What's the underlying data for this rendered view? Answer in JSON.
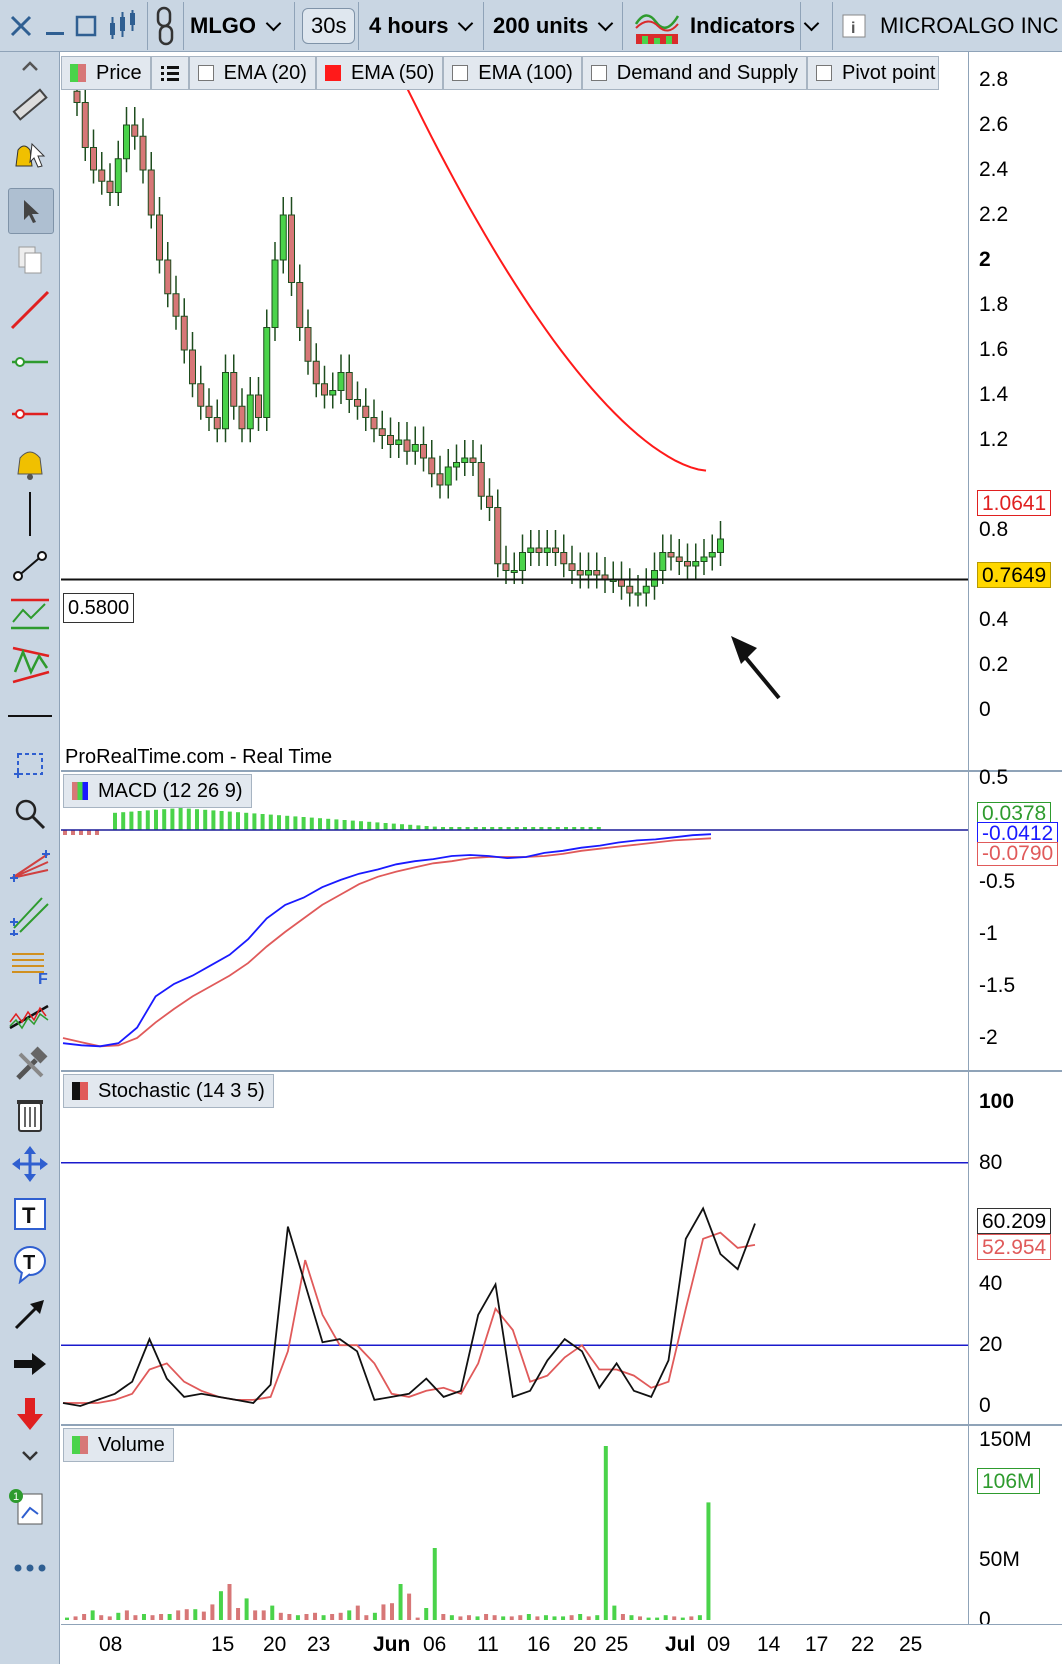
{
  "toolbar": {
    "symbol": "MLGO",
    "refresh": "30s",
    "period": "4 hours",
    "units": "200 units",
    "indicators": "Indicators",
    "instrument": "MICROALGO INC"
  },
  "price_panel": {
    "legend": [
      "Price",
      "EMA (20)",
      "EMA (50)",
      "EMA (100)",
      "Demand and Supply",
      "Pivot point"
    ],
    "source": "ProRealTime.com - Real Time",
    "hline_label": "0.5800",
    "ema50_value": "1.0641",
    "last_price": "0.7649",
    "yticks": [
      "2.8",
      "2.6",
      "2.4",
      "2.2",
      "2",
      "1.8",
      "1.6",
      "1.4",
      "1.2",
      "",
      "0.8",
      "0.6",
      "0.4",
      "0.2",
      "0"
    ]
  },
  "macd_panel": {
    "legend": "MACD (12 26 9)",
    "hist_value": "0.0378",
    "macd_value": "-0.0412",
    "signal_value": "-0.0790",
    "yticks": [
      "0.5",
      "-0.5",
      "-1",
      "-1.5",
      "-2"
    ]
  },
  "stoch_panel": {
    "legend": "Stochastic (14 3 5)",
    "k_value": "60.209",
    "d_value": "52.954",
    "yticks": [
      "100",
      "80",
      "40",
      "20",
      "0"
    ]
  },
  "volume_panel": {
    "legend": "Volume",
    "value": "106M",
    "yticks": [
      "150M",
      "50M",
      "0"
    ]
  },
  "xaxis": [
    "08",
    "15",
    "20",
    "23",
    "Jun",
    "06",
    "11",
    "16",
    "20",
    "25",
    "Jul",
    "09",
    "14",
    "17",
    "22",
    "25"
  ],
  "colors": {
    "up": "#4ad34a",
    "down": "#d77777",
    "ema50": "#ff1a1a",
    "macd": "#1a1aff",
    "signal": "#e05a5a",
    "stoch_level": "#1a1acc",
    "toolbar_bg": "#c9d6e3",
    "price_tag": "#ffd700"
  },
  "chart_data": [
    {
      "type": "candlestick",
      "title": "Price",
      "ylim": [
        0,
        2.9
      ],
      "hline": 0.58,
      "ema50_last": 1.0641,
      "last": 0.7649,
      "series": [
        {
          "name": "Price",
          "values": [
            2.7,
            2.5,
            2.4,
            2.35,
            2.3,
            2.45,
            2.6,
            2.55,
            2.4,
            2.2,
            2.0,
            1.85,
            1.75,
            1.6,
            1.45,
            1.35,
            1.3,
            1.25,
            1.5,
            1.35,
            1.25,
            1.4,
            1.3,
            1.7,
            2.0,
            2.2,
            1.9,
            1.7,
            1.55,
            1.45,
            1.4,
            1.42,
            1.5,
            1.38,
            1.35,
            1.3,
            1.25,
            1.22,
            1.18,
            1.2,
            1.15,
            1.18,
            1.12,
            1.05,
            1.0,
            1.08,
            1.1,
            1.12,
            1.1,
            0.95,
            0.9,
            0.65,
            0.62,
            0.62,
            0.7,
            0.72,
            0.7,
            0.72,
            0.7,
            0.65,
            0.62,
            0.6,
            0.62,
            0.6,
            0.58,
            0.58,
            0.55,
            0.52,
            0.52,
            0.55,
            0.62,
            0.7,
            0.68,
            0.66,
            0.64,
            0.66,
            0.68,
            0.7,
            0.76
          ]
        }
      ]
    },
    {
      "type": "line",
      "title": "MACD (12 26 9)",
      "ylim": [
        -2.2,
        0.5
      ],
      "series": [
        {
          "name": "MACD",
          "values": [
            -2.05,
            -2.07,
            -2.08,
            -2.05,
            -1.9,
            -1.6,
            -1.48,
            -1.4,
            -1.3,
            -1.2,
            -1.05,
            -0.85,
            -0.72,
            -0.65,
            -0.55,
            -0.48,
            -0.42,
            -0.38,
            -0.33,
            -0.3,
            -0.28,
            -0.25,
            -0.24,
            -0.25,
            -0.27,
            -0.26,
            -0.22,
            -0.2,
            -0.17,
            -0.15,
            -0.12,
            -0.1,
            -0.09,
            -0.07,
            -0.05,
            -0.04
          ]
        },
        {
          "name": "Signal",
          "values": [
            -2.0,
            -2.04,
            -2.08,
            -2.07,
            -2.0,
            -1.85,
            -1.72,
            -1.6,
            -1.5,
            -1.4,
            -1.28,
            -1.12,
            -0.98,
            -0.85,
            -0.72,
            -0.62,
            -0.52,
            -0.45,
            -0.4,
            -0.36,
            -0.32,
            -0.3,
            -0.27,
            -0.26,
            -0.26,
            -0.26,
            -0.25,
            -0.23,
            -0.2,
            -0.18,
            -0.16,
            -0.14,
            -0.12,
            -0.1,
            -0.09,
            -0.08
          ]
        }
      ]
    },
    {
      "type": "line",
      "title": "Stochastic (14 3 5)",
      "ylim": [
        0,
        100
      ],
      "levels": [
        80,
        20
      ],
      "series": [
        {
          "name": "%K",
          "values": [
            1,
            0,
            2,
            4,
            8,
            22,
            9,
            3,
            4,
            3,
            2,
            1,
            7,
            59,
            40,
            21,
            22,
            18,
            2,
            3,
            4,
            9,
            3,
            5,
            30,
            40,
            3,
            5,
            15,
            22,
            18,
            6,
            14,
            5,
            3,
            15,
            55,
            65,
            50,
            45,
            60
          ]
        },
        {
          "name": "%D",
          "values": [
            1,
            1,
            1,
            2,
            4,
            12,
            14,
            8,
            5,
            3,
            2,
            2,
            3,
            18,
            48,
            30,
            20,
            20,
            14,
            4,
            3,
            5,
            6,
            4,
            14,
            32,
            25,
            8,
            10,
            16,
            20,
            12,
            12,
            10,
            6,
            8,
            32,
            55,
            57,
            52,
            53
          ]
        }
      ]
    },
    {
      "type": "bar",
      "title": "Volume",
      "ylim": [
        0,
        155
      ],
      "series": [
        {
          "name": "Volume (M)",
          "values": [
            2,
            3,
            5,
            8,
            4,
            3,
            6,
            8,
            4,
            5,
            4,
            5,
            5,
            8,
            9,
            9,
            7,
            13,
            24,
            30,
            10,
            18,
            8,
            8,
            12,
            6,
            5,
            4,
            5,
            6,
            4,
            5,
            6,
            8,
            12,
            4,
            6,
            13,
            14,
            30,
            22,
            2,
            10,
            60,
            5,
            4,
            3,
            4,
            3,
            5,
            4,
            3,
            3,
            4,
            5,
            3,
            4,
            3,
            3,
            4,
            5,
            3,
            4,
            145,
            12,
            5,
            4,
            3,
            2,
            2,
            4,
            3,
            2,
            3,
            4,
            98
          ]
        }
      ]
    }
  ]
}
